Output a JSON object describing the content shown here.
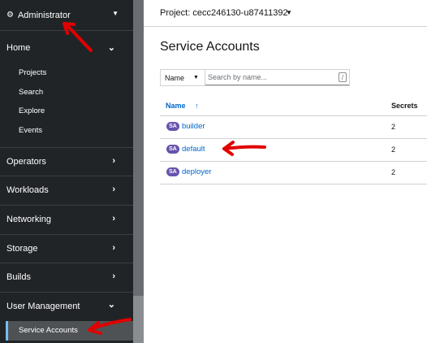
{
  "sidebar": {
    "perspective": {
      "icon": "cogs-icon",
      "label": "Administrator"
    },
    "sections": [
      {
        "label": "Home",
        "expanded": true,
        "items": [
          "Projects",
          "Search",
          "Explore",
          "Events"
        ]
      },
      {
        "label": "Operators",
        "expanded": false
      },
      {
        "label": "Workloads",
        "expanded": false
      },
      {
        "label": "Networking",
        "expanded": false
      },
      {
        "label": "Storage",
        "expanded": false
      },
      {
        "label": "Builds",
        "expanded": false
      },
      {
        "label": "User Management",
        "expanded": true,
        "items": [
          "Service Accounts"
        ]
      }
    ],
    "active_item": "Service Accounts"
  },
  "topbar": {
    "project_label": "Project: cecc246130-u87411392"
  },
  "page": {
    "title": "Service Accounts"
  },
  "filter": {
    "type": "Name",
    "placeholder": "Search by name...",
    "shortcut": "/"
  },
  "table": {
    "columns": [
      "Name",
      "Secrets"
    ],
    "sort_glyph": "↑",
    "rows": [
      {
        "badge": "SA",
        "name": "builder",
        "secrets": "2"
      },
      {
        "badge": "SA",
        "name": "default",
        "secrets": "2"
      },
      {
        "badge": "SA",
        "name": "deployer",
        "secrets": "2"
      }
    ]
  },
  "colors": {
    "sidebar_bg": "#212427",
    "link": "#0066cc",
    "badge": "#6753ac",
    "annotation": "#e00000"
  }
}
